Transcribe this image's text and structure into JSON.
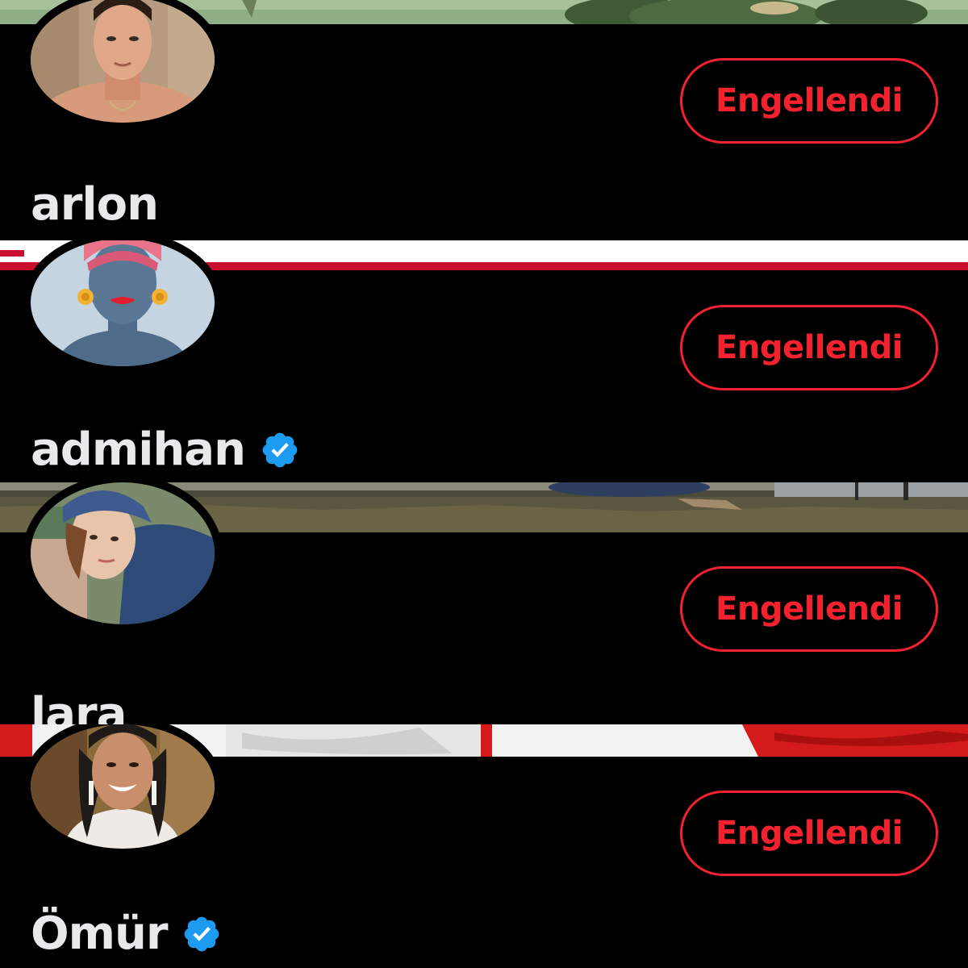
{
  "colors": {
    "background": "#000000",
    "block_button": "#f4212e",
    "name_text": "#e7e9ea",
    "verified_badge": "#1d9bf0"
  },
  "users": [
    {
      "display_name": "arlon",
      "verified": false,
      "button_label": "Engellendi",
      "avatar_icon": "profile-photo-man",
      "banner": "green-illustration"
    },
    {
      "display_name": "admihan",
      "verified": true,
      "button_label": "Engellendi",
      "avatar_icon": "woman-illustration",
      "banner": "white-red-stripe"
    },
    {
      "display_name": "lara",
      "verified": false,
      "button_label": "Engellendi",
      "avatar_icon": "profile-photo-woman-cap",
      "banner": "grass-field-photo"
    },
    {
      "display_name": "Ömür",
      "verified": true,
      "button_label": "Engellendi",
      "avatar_icon": "profile-photo-woman-smiling",
      "banner": "red-white-flag"
    }
  ]
}
